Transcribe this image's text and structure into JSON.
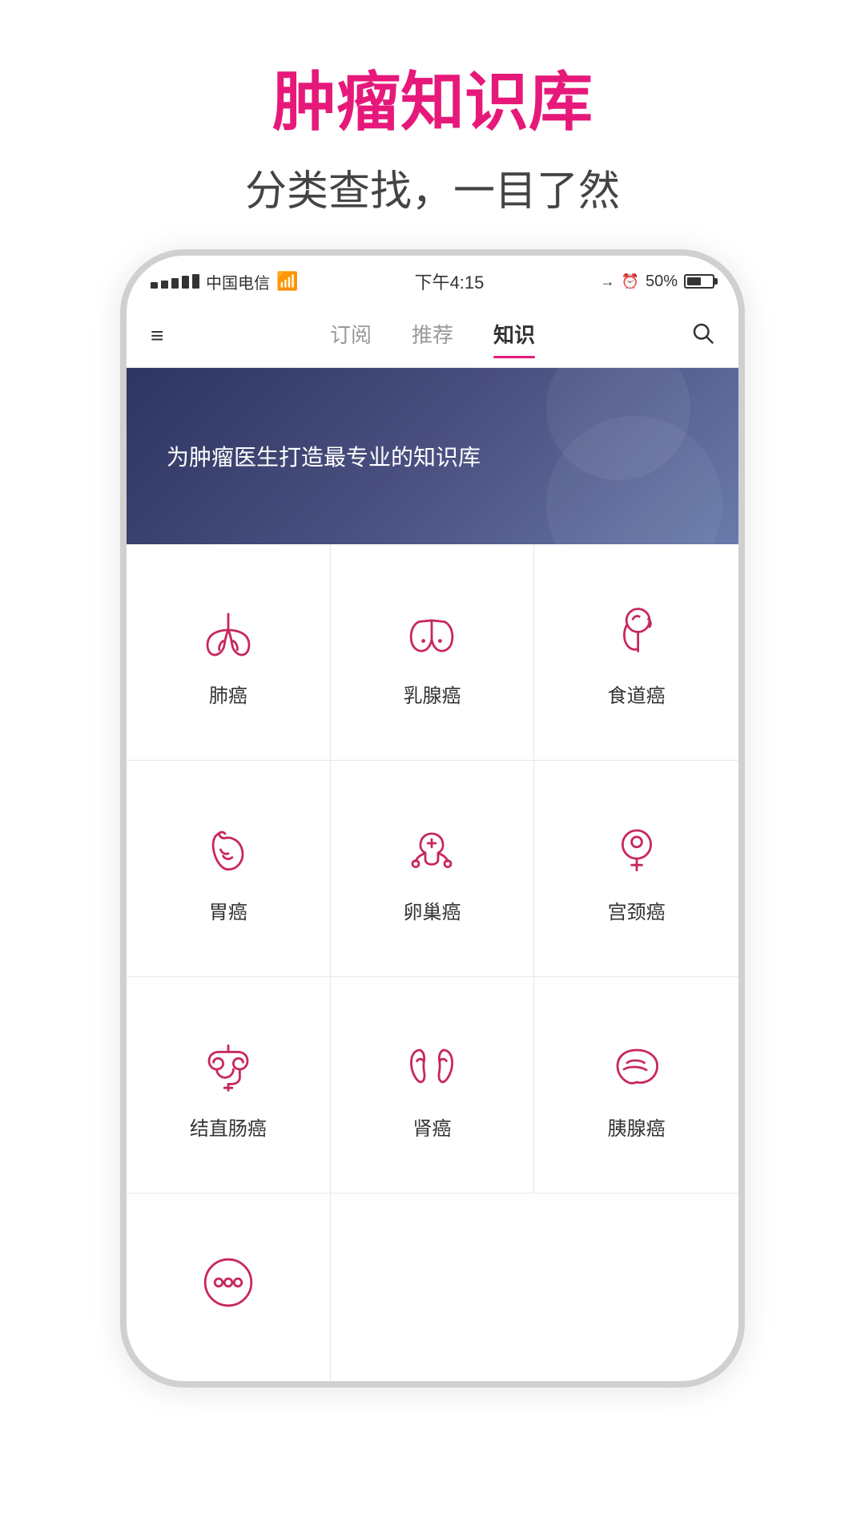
{
  "page": {
    "title": "肿瘤知识库",
    "subtitle": "分类查找，一目了然"
  },
  "status_bar": {
    "carrier": "中国电信",
    "time": "下午4:15",
    "battery_percent": "50%"
  },
  "nav": {
    "tabs": [
      {
        "id": "subscribe",
        "label": "订阅",
        "active": false
      },
      {
        "id": "recommend",
        "label": "推荐",
        "active": false
      },
      {
        "id": "knowledge",
        "label": "知识",
        "active": true
      }
    ]
  },
  "banner": {
    "text": "为肿瘤医生打造最专业的知识库"
  },
  "cancer_types": [
    {
      "id": "lung",
      "label": "肺癌",
      "icon": "lung"
    },
    {
      "id": "breast",
      "label": "乳腺癌",
      "icon": "breast"
    },
    {
      "id": "esophagus",
      "label": "食道癌",
      "icon": "esophagus"
    },
    {
      "id": "stomach",
      "label": "胃癌",
      "icon": "stomach"
    },
    {
      "id": "ovary",
      "label": "卵巢癌",
      "icon": "ovary"
    },
    {
      "id": "cervix",
      "label": "宫颈癌",
      "icon": "cervix"
    },
    {
      "id": "colon",
      "label": "结直肠癌",
      "icon": "colon"
    },
    {
      "id": "kidney",
      "label": "肾癌",
      "icon": "kidney"
    },
    {
      "id": "pancreas",
      "label": "胰腺癌",
      "icon": "pancreas"
    },
    {
      "id": "other",
      "label": "",
      "icon": "other"
    }
  ],
  "colors": {
    "primary_pink": "#e6197a",
    "icon_red": "#c8275e",
    "banner_bg": "#2d3561",
    "text_dark": "#333333",
    "text_gray": "#999999"
  }
}
